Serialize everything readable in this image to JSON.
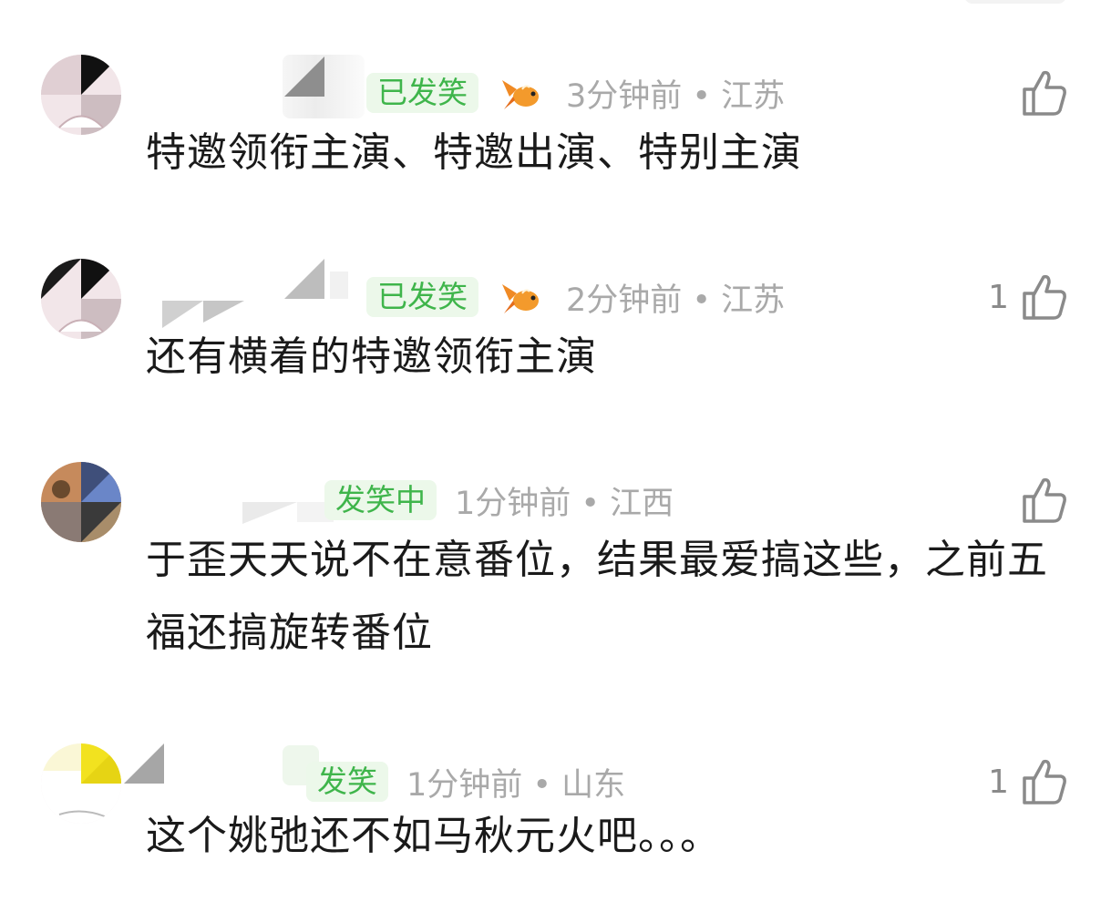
{
  "comments": [
    {
      "badge": "已发笑",
      "meta": "3分钟前 • 江苏",
      "likes": "",
      "content": "特邀领衔主演、特邀出演、特别主演"
    },
    {
      "badge": "已发笑",
      "meta": "2分钟前 • 江苏",
      "likes": "1",
      "content": "还有横着的特邀领衔主演"
    },
    {
      "badge": "发笑中",
      "meta": "1分钟前 • 江西",
      "likes": "",
      "content": "于歪天天说不在意番位，结果最爱搞这些，之前五福还搞旋转番位"
    },
    {
      "badge": "发笑",
      "meta": "1分钟前 • 山东",
      "likes": "1",
      "content": "这个姚弛还不如马秋元火吧。。。"
    }
  ],
  "colors": {
    "badge_text": "#3fb54b",
    "badge_bg": "#ecf8ea",
    "meta": "#a9a9a9",
    "content": "#1a1a1a"
  }
}
